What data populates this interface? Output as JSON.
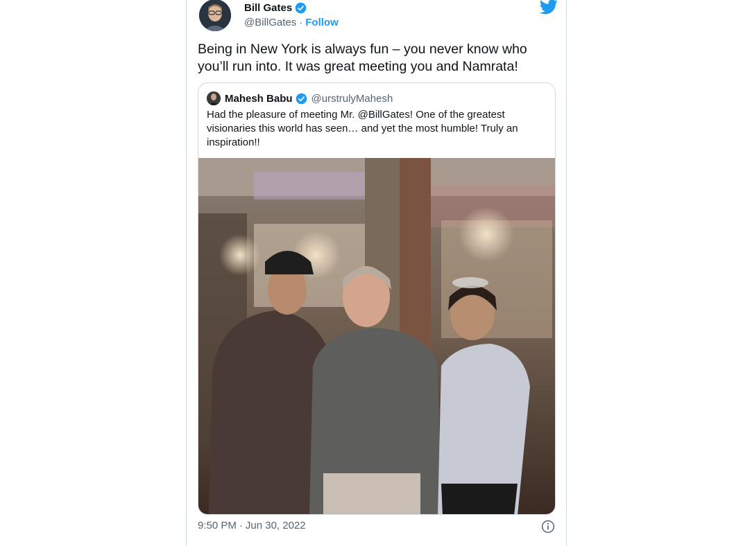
{
  "tweet": {
    "author_name": "Bill Gates",
    "author_handle": "@BillGates",
    "separator": "·",
    "follow_label": "Follow",
    "text": "Being in New York is always fun – you never know who you’ll run into. It was great meeting you and Namrata!",
    "time": "9:50 PM",
    "date": "Jun 30, 2022"
  },
  "quoted": {
    "author_name": "Mahesh Babu",
    "author_handle": "@urstrulyMahesh",
    "text": "Had the pleasure of meeting Mr. @BillGates! One of the greatest visionaries this world has seen… and yet the most humble! Truly an inspiration!!"
  },
  "icons": {
    "verified": "verified-badge-icon",
    "brand": "twitter-bird-icon",
    "info": "info-icon"
  },
  "colors": {
    "accent": "#1d9bf0",
    "text": "#0f1419",
    "secondary": "#536471",
    "border": "#cfd9de"
  }
}
